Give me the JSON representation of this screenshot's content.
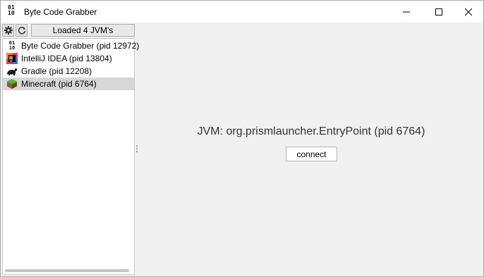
{
  "window": {
    "title": "Byte Code Grabber",
    "app_icon_text": "01\n10"
  },
  "toolbar": {
    "settings_icon": "gear-icon",
    "refresh_icon": "refresh-icon",
    "status_label": "Loaded 4 JVM's"
  },
  "jvm_list": {
    "items": [
      {
        "label": "Byte Code Grabber (pid 12972)",
        "icon": "binary-icon",
        "selected": false
      },
      {
        "label": "IntelliJ IDEA (pid 13804)",
        "icon": "intellij-icon",
        "selected": false
      },
      {
        "label": "Gradle (pid 12208)",
        "icon": "gradle-icon",
        "selected": false
      },
      {
        "label": "Minecraft (pid 6764)",
        "icon": "minecraft-icon",
        "selected": true
      }
    ]
  },
  "details": {
    "jvm_text": "JVM: org.prismlauncher.EntryPoint (pid 6764)",
    "connect_label": "connect"
  },
  "colors": {
    "selection": "#d7d7d7",
    "panel_bg": "#f0f0f0",
    "list_bg": "#ffffff"
  }
}
